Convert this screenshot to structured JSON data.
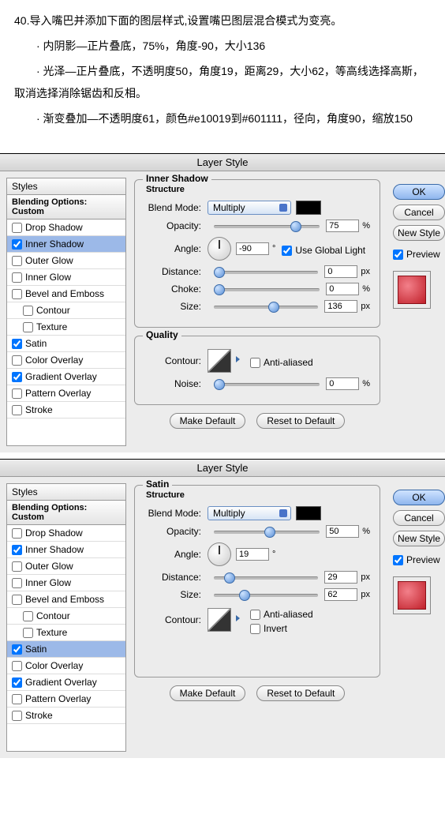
{
  "instructions": {
    "step": "40.导入嘴巴并添加下面的图层样式,设置嘴巴图层混合模式为变亮。",
    "line1": "· 内阴影—正片叠底，75%，角度-90，大小136",
    "line2": "· 光泽—正片叠底，不透明度50，角度19，距离29，大小62，等高线选择高斯，取消选择消除锯齿和反相。",
    "line3": "· 渐变叠加—不透明度61，颜色#e10019到#601111，径向，角度90，缩放150"
  },
  "dialog_title": "Layer Style",
  "styles_header": "Styles",
  "styles_sub": "Blending Options: Custom",
  "style_items": [
    {
      "label": "Drop Shadow",
      "checked": false
    },
    {
      "label": "Inner Shadow",
      "checked": true
    },
    {
      "label": "Outer Glow",
      "checked": false
    },
    {
      "label": "Inner Glow",
      "checked": false
    },
    {
      "label": "Bevel and Emboss",
      "checked": false
    },
    {
      "label": "Contour",
      "checked": false,
      "indent": true
    },
    {
      "label": "Texture",
      "checked": false,
      "indent": true
    },
    {
      "label": "Satin",
      "checked": true
    },
    {
      "label": "Color Overlay",
      "checked": false
    },
    {
      "label": "Gradient Overlay",
      "checked": true
    },
    {
      "label": "Pattern Overlay",
      "checked": false
    },
    {
      "label": "Stroke",
      "checked": false
    }
  ],
  "labels": {
    "structure": "Structure",
    "quality": "Quality",
    "blend_mode": "Blend Mode:",
    "opacity": "Opacity:",
    "angle": "Angle:",
    "distance": "Distance:",
    "choke": "Choke:",
    "size": "Size:",
    "contour": "Contour:",
    "noise": "Noise:",
    "anti": "Anti-aliased",
    "invert": "Invert",
    "global": "Use Global Light",
    "make_default": "Make Default",
    "reset_default": "Reset to Default",
    "ok": "OK",
    "cancel": "Cancel",
    "new_style": "New Style",
    "preview": "Preview"
  },
  "panel1": {
    "name": "Inner Shadow",
    "blend": "Multiply",
    "opacity": "75",
    "angle": "-90",
    "distance": "0",
    "choke": "0",
    "size": "136",
    "noise": "0"
  },
  "panel2": {
    "name": "Satin",
    "blend": "Multiply",
    "opacity": "50",
    "angle": "19",
    "distance": "29",
    "size": "62"
  }
}
